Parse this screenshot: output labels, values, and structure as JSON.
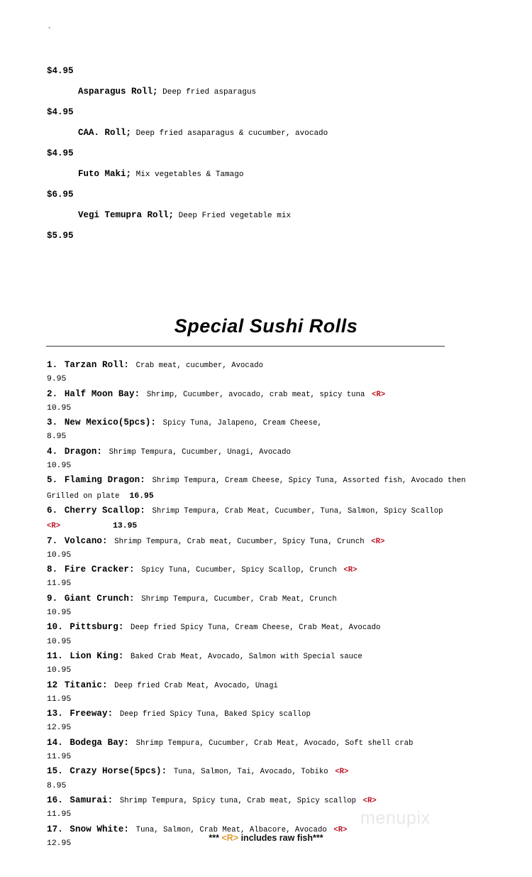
{
  "document": {
    "stray_mark": "`",
    "watermark": "menupix",
    "background_color": "#ffffff",
    "text_color": "#000000",
    "raw_flag_color": "#BB1122",
    "footer_flag_color": "#E09B2D",
    "rule_color": "#3a3a3a"
  },
  "veggie_section": {
    "leading_price": "$4.95",
    "items": [
      {
        "name": "Asparagus Roll;",
        "description": "Deep fried asparagus",
        "price": "$4.95"
      },
      {
        "name": "CAA. Roll;",
        "description": "Deep fried asaparagus & cucumber, avocado",
        "price": "$4.95"
      },
      {
        "name": "Futo Maki;",
        "description": "Mix vegetables & Tamago",
        "price": "$6.95"
      },
      {
        "name": "Vegi Temupra Roll;",
        "description": "Deep Fried vegetable mix",
        "price": "$5.95"
      }
    ]
  },
  "special_rolls": {
    "title": "Special Sushi Rolls",
    "raw_flag_label": "<R>",
    "items": [
      {
        "number": "1.",
        "name": "Tarzan Roll:",
        "description": "Crab meat, cucumber, Avocado",
        "raw": false,
        "price": "9.95",
        "price_inline": false
      },
      {
        "number": "2.",
        "name": "Half Moon Bay:",
        "description": "Shrimp, Cucumber, avocado, crab meat, spicy tuna",
        "raw": true,
        "price": "10.95",
        "price_inline": false
      },
      {
        "number": "3.",
        "name": "New Mexico(5pcs):",
        "description": "Spicy Tuna, Jalapeno, Cream Cheese,",
        "raw": false,
        "price": "8.95",
        "price_inline": false
      },
      {
        "number": "4.",
        "name": "Dragon:",
        "description": "Shrimp Tempura, Cucumber, Unagi, Avocado",
        "raw": false,
        "price": "10.95",
        "price_inline": false
      },
      {
        "number": "5.",
        "name": "Flaming Dragon:",
        "description": "Shrimp Tempura, Cream Cheese, Spicy Tuna, Assorted fish, Avocado then Grilled on plate",
        "raw": false,
        "price": "16.95",
        "price_inline": true,
        "price_inline_wide": false
      },
      {
        "number": "6.",
        "name": "Cherry Scallop:",
        "description": "Shrimp Tempura, Crab Meat, Cucumber, Tuna, Salmon, Spicy Scallop",
        "raw": true,
        "price": "13.95",
        "price_inline": true,
        "price_inline_wide": true
      },
      {
        "number": "7.",
        "name": "Volcano:",
        "description": "Shrimp Tempura, Crab meat, Cucumber, Spicy Tuna, Crunch",
        "raw": true,
        "price": "10.95",
        "price_inline": false
      },
      {
        "number": "8.",
        "name": "Fire Cracker:",
        "description": "Spicy Tuna, Cucumber, Spicy Scallop, Crunch",
        "raw": true,
        "price": "11.95",
        "price_inline": false
      },
      {
        "number": "9.",
        "name": "Giant Crunch:",
        "description": "Shrimp Tempura, Cucumber, Crab Meat, Crunch",
        "raw": false,
        "price": "10.95",
        "price_inline": false
      },
      {
        "number": "10.",
        "name": "Pittsburg:",
        "description": "Deep fried Spicy Tuna, Cream Cheese, Crab Meat, Avocado",
        "raw": false,
        "price": "10.95",
        "price_inline": false
      },
      {
        "number": "11.",
        "name": "Lion King:",
        "description": "Baked Crab Meat, Avocado, Salmon with Special sauce",
        "raw": false,
        "price": "10.95",
        "price_inline": false
      },
      {
        "number": "12",
        "name": "Titanic:",
        "description": "Deep fried Crab Meat, Avocado, Unagi",
        "raw": false,
        "price": "11.95",
        "price_inline": false
      },
      {
        "number": "13.",
        "name": "Freeway:",
        "description": "Deep fried Spicy Tuna, Baked Spicy scallop",
        "raw": false,
        "price": "12.95",
        "price_inline": false
      },
      {
        "number": "14.",
        "name": "Bodega Bay:",
        "description": "Shrimp Tempura, Cucumber, Crab Meat, Avocado, Soft shell crab",
        "raw": false,
        "price": "11.95",
        "price_inline": false
      },
      {
        "number": "15.",
        "name": "Crazy Horse(5pcs):",
        "description": "Tuna, Salmon, Tai, Avocado, Tobiko",
        "raw": true,
        "price": "8.95",
        "price_inline": false
      },
      {
        "number": "16.",
        "name": "Samurai:",
        "description": "Shrimp Tempura, Spicy tuna, Crab meat, Spicy scallop",
        "raw": true,
        "price": "11.95",
        "price_inline": false
      },
      {
        "number": "17.",
        "name": "Snow White:",
        "description": "Tuna, Salmon, Crab Meat, Albacore, Avocado",
        "raw": true,
        "price": "12.95",
        "price_inline": false
      }
    ]
  },
  "footer": {
    "prefix": "*** ",
    "flag": "<R>",
    "text": " includes raw fish***"
  }
}
